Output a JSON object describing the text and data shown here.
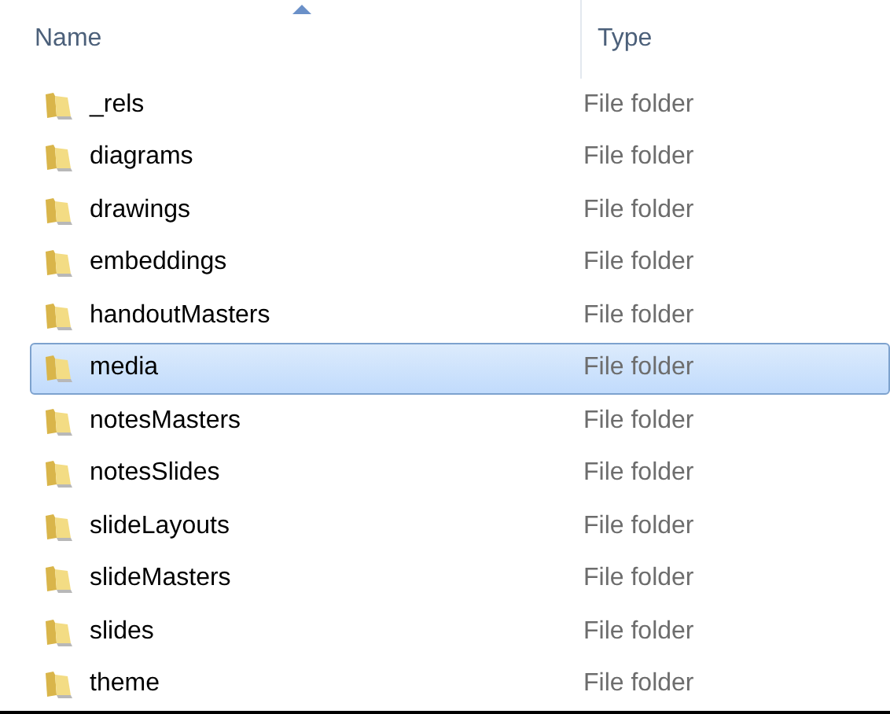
{
  "columns": [
    {
      "label": "Name",
      "sorted": true
    },
    {
      "label": "Type",
      "sorted": false
    }
  ],
  "rows": [
    {
      "name": "_rels",
      "type": "File folder",
      "selected": false
    },
    {
      "name": "diagrams",
      "type": "File folder",
      "selected": false
    },
    {
      "name": "drawings",
      "type": "File folder",
      "selected": false
    },
    {
      "name": "embeddings",
      "type": "File folder",
      "selected": false
    },
    {
      "name": "handoutMasters",
      "type": "File folder",
      "selected": false
    },
    {
      "name": "media",
      "type": "File folder",
      "selected": true
    },
    {
      "name": "notesMasters",
      "type": "File folder",
      "selected": false
    },
    {
      "name": "notesSlides",
      "type": "File folder",
      "selected": false
    },
    {
      "name": "slideLayouts",
      "type": "File folder",
      "selected": false
    },
    {
      "name": "slideMasters",
      "type": "File folder",
      "selected": false
    },
    {
      "name": "slides",
      "type": "File folder",
      "selected": false
    },
    {
      "name": "theme",
      "type": "File folder",
      "selected": false
    }
  ]
}
